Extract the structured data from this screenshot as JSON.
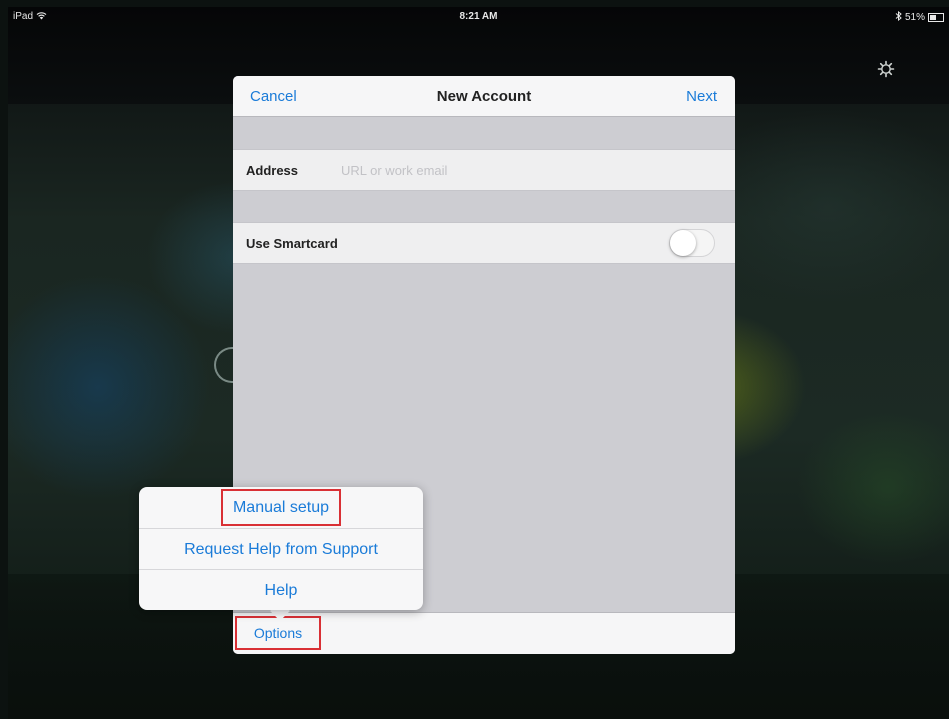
{
  "status_bar": {
    "device": "iPad",
    "wifi_icon": "wifi-icon",
    "time": "8:21 AM",
    "bluetooth_icon": "bluetooth-icon",
    "battery": "51%",
    "battery_level": 0.51
  },
  "background": {
    "settings_icon": "gear-icon"
  },
  "dialog": {
    "cancel_label": "Cancel",
    "title": "New Account",
    "next_label": "Next",
    "address": {
      "label": "Address",
      "placeholder": "URL or work email",
      "value": ""
    },
    "smartcard": {
      "label": "Use Smartcard",
      "on": false
    },
    "footer": {
      "options_label": "Options"
    }
  },
  "options_menu": {
    "items": [
      {
        "label": "Manual setup",
        "highlighted": true
      },
      {
        "label": "Request Help from Support",
        "highlighted": false
      },
      {
        "label": "Help",
        "highlighted": false
      }
    ]
  },
  "colors": {
    "accent": "#1a7bd8",
    "highlight_box": "#d93035"
  }
}
